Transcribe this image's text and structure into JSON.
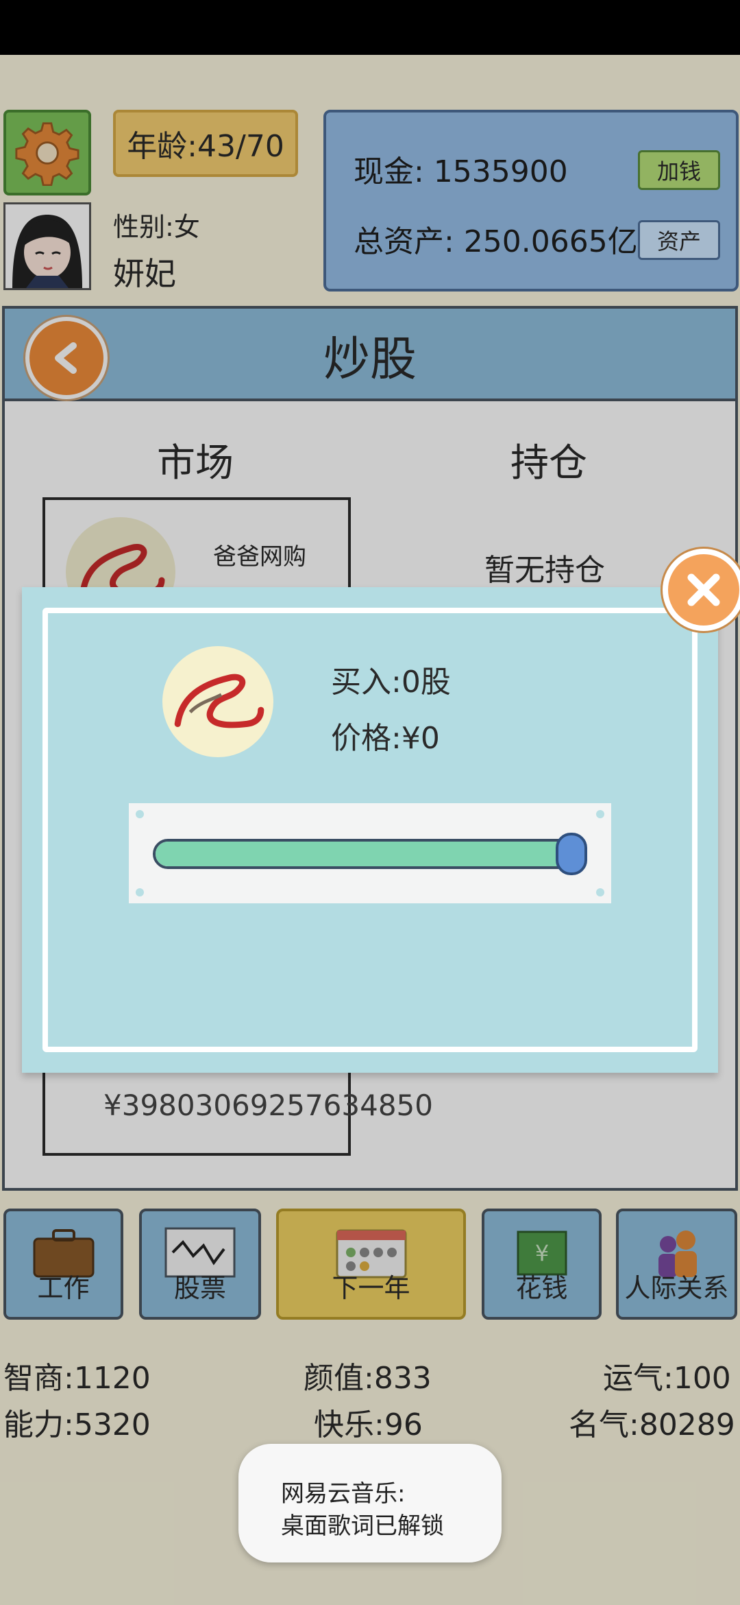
{
  "header": {
    "age_label": "年龄:43/70",
    "gender_label": "性别:女",
    "name": "妍妃",
    "cash_label": "现金: 1535900",
    "total_assets_label": "总资产: 250.0665亿",
    "add_money_button": "加钱",
    "assets_button": "资产"
  },
  "stock": {
    "title": "炒股",
    "tab_market": "市场",
    "tab_holdings": "持仓",
    "card_name": "爸爸网购",
    "card_price": "¥39803069257634850",
    "no_holdings": "暂无持仓"
  },
  "modal": {
    "buy_label": "买入:0股",
    "price_label": "价格:¥0",
    "slider_fraction": 0.97
  },
  "nav": {
    "work": "工作",
    "stocks": "股票",
    "next_year": "下一年",
    "spend": "花钱",
    "relations": "人际关系"
  },
  "stats": {
    "iq": "智商:1120",
    "looks": "颜值:833",
    "luck": "运气:100",
    "ability": "能力:5320",
    "happiness": "快乐:96",
    "fame": "名气:80289"
  },
  "toast": {
    "line1": "网易云音乐:",
    "line2": "桌面歌词已解锁"
  },
  "colors": {
    "background": "#faf6df",
    "panel_blue": "#8fbfdc",
    "modal": "#b3dce2",
    "slider_fill": "#7fd4b0",
    "accent_orange": "#ef8d3a"
  }
}
